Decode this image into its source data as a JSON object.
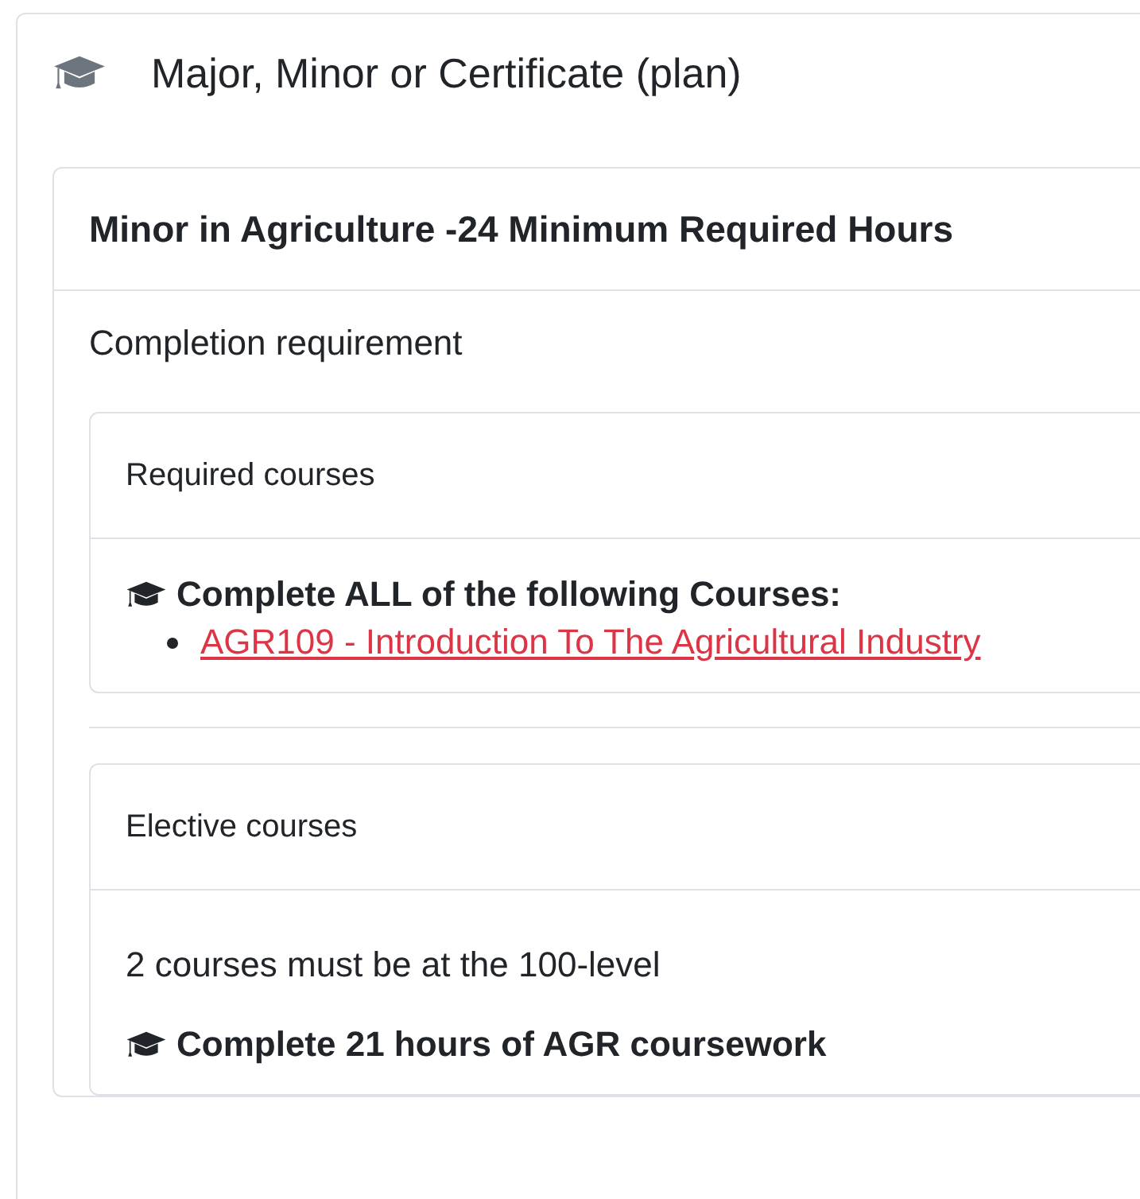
{
  "panel": {
    "title": "Major, Minor or Certificate (plan)",
    "plan": {
      "title": "Minor in Agriculture -24 Minimum Required Hours",
      "subtitle": "Completion requirement",
      "sections": [
        {
          "title": "Required courses",
          "rule": "Complete ALL of the following Courses:",
          "courses": [
            "AGR109 - Introduction To The Agricultural Industry"
          ]
        },
        {
          "title": "Elective courses",
          "note": "2 courses must be at the 100-level",
          "rule": "Complete 21 hours of AGR coursework"
        }
      ]
    }
  }
}
